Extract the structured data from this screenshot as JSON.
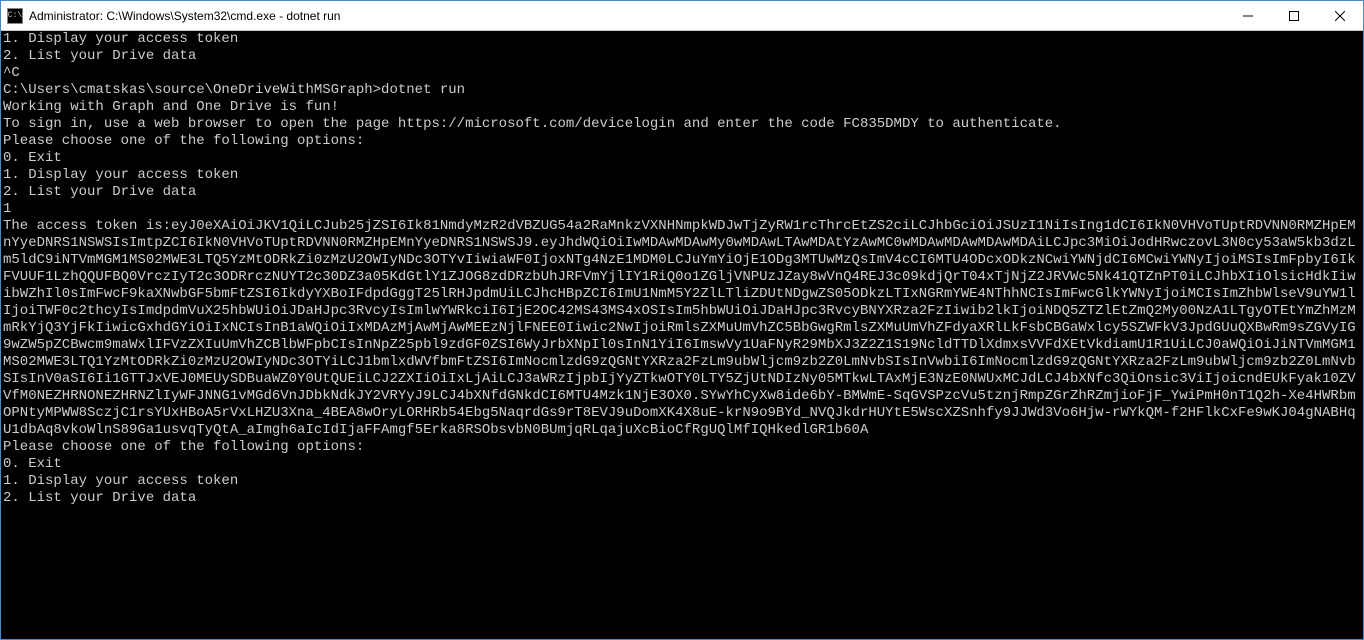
{
  "titlebar": {
    "icon_label": "C:\\",
    "title": "Administrator: C:\\Windows\\System32\\cmd.exe - dotnet  run"
  },
  "terminal": {
    "lines": [
      "1. Display your access token",
      "2. List your Drive data",
      "^C",
      "C:\\Users\\cmatskas\\source\\OneDriveWithMSGraph>dotnet run",
      "Working with Graph and One Drive is fun!",
      "To sign in, use a web browser to open the page https://microsoft.com/devicelogin and enter the code FC835DMDY to authenticate.",
      "Please choose one of the following options:",
      "0. Exit",
      "1. Display your access token",
      "2. List your Drive data",
      "1",
      "The access token is:eyJ0eXAiOiJKV1QiLCJub25jZSI6Ik81NmdyMzR2dVBZUG54a2RaMnkzVXNHNmpkWDJwTjZyRW1rcThrcEtZS2ciLCJhbGciOiJSUzI1NiIsIng1dCI6IkN0VHVoTUptRDVNN0RMZHpEMnYyeDNRS1NSWSIsImtpZCI6IkN0VHVoTUptRDVNN0RMZHpEMnYyeDNRS1NSWSJ9.eyJhdWQiOiIwMDAwMDAwMy0wMDAwLTAwMDAtYzAwMC0wMDAwMDAwMDAwMDAiLCJpc3MiOiJodHRwczovL3N0cy53aW5kb3dzLm5ldC9iNTVmMGM1MS02MWE3LTQ5YzMtODRkZi0zMzU2OWIyNDc3OTYvIiwiaWF0IjoxNTg4NzE1MDM0LCJuYmYiOjE1ODg3MTUwMzQsImV4cCI6MTU4ODcxODkzNCwiYWNjdCI6MCwiYWNyIjoiMSIsImFpbyI6IkFVUUF1LzhQQUFBQ0VrczIyT2c3ODRrczNUYT2c30DZ3a05KdGtlY1ZJOG8zdDRzbUhJRFVmYjlIY1RiQ0o1ZGljVNPUzJZay8wVnQ4REJ3c09kdjQrT04xTjNjZ2JRVWc5Nk41QTZnPT0iLCJhbXIiOlsicHdkIiwibWZhIl0sImFwcF9kaXNwbGF5bmFtZSI6IkdyYXBoIFdpdGggT25lRHJpdmUiLCJhcHBpZCI6ImU1NmM5Y2ZlLTliZDUtNDgwZS05ODkzLTIxNGRmYWE4NThhNCIsImFwcGlkYWNyIjoiMCIsImZhbWlseV9uYW1lIjoiTWF0c2thcyIsImdpdmVuX25hbWUiOiJDaHJpc3RvcyIsImlwYWRkciI6IjE2OC42MS43MS4xOSIsIm5hbWUiOiJDaHJpc3RvcyBNYXRza2FzIiwib2lkIjoiNDQ5ZTZlEtZmQ2My00NzA1LTgyOTEtYmZhMzMmRkYjQ3YjFkIiwicGxhdGYiOiIxNCIsInB1aWQiOiIxMDAzMjAwMjAwMEEzNjlFNEE0Iiwic2NwIjoiRmlsZXMuUmVhZC5BbGwgRmlsZXMuUmVhZFdyaXRlLkFsbCBGaWxlcy5SZWFkV3JpdGUuQXBwRm9sZGVyIG9wZW5pZCBwcm9maWxlIFVzZXIuUmVhZCBlbWFpbCIsInNpZ25pbl9zdGF0ZSI6WyJrbXNpIl0sInN1YiI6ImswVy1UaFNyR29MbXJ3Z2Z1S19NcldTTDlXdmxsVVFdXEtVkdiamU1R1UiLCJ0aWQiOiJiNTVmMGM1MS02MWE3LTQ1YzMtODRkZi0zMzU2OWIyNDc3OTYiLCJ1bmlxdWVfbmFtZSI6ImNocmlzdG9zQGNtYXRza2FzLm9ubWljcm9zb2Z0LmNvbSIsInVwbiI6ImNocmlzdG9zQGNtYXRza2FzLm9ubWljcm9zb2Z0LmNvbSIsInV0aSI6Ii1GTTJxVEJ0MEUySDBuaWZ0Y0UtQUEiLCJ2ZXIiOiIxLjAiLCJ3aWRzIjpbIjYyZTkwOTY0LTY5ZjUtNDIzNy05MTkwLTAxMjE3NzE0NWUxMCJdLCJ4bXNfc3QiOnsic3ViIjoicndEUkFyak10ZVVfM0NEZHRNONEZHRNZlIyWFJNNG1vMGd6VnJDbkNdkJY2VRYyJ9LCJ4bXNfdGNkdCI6MTU4Mzk1NjE3OX0.SYwYhCyXw8ide6bY-BMWmE-SqGVSPzcVu5tznjRmpZGrZhRZmjioFjF_YwiPmH0nT1Q2h-Xe4HWRbmOPNtyMPWW8SczjC1rsYUxHBoA5rVxLHZU3Xna_4BEA8wOryLORHRb54Ebg5NaqrdGs9rT8EVJ9uDomXK4X8uE-krN9o9BYd_NVQJkdrHUYtE5WscXZSnhfy9JJWd3Vo6Hjw-rWYkQM-f2HFlkCxFe9wKJ04gNABHqU1dbAq8vkoWlnS89Ga1usvqTyQtA_aImgh6aIcIdIjaFFAmgf5Erka8RSObsvbN0BUmjqRLqajuXcBioCfRgUQlMfIQHkedlGR1b60A",
      "Please choose one of the following options:",
      "0. Exit",
      "1. Display your access token",
      "2. List your Drive data"
    ]
  }
}
